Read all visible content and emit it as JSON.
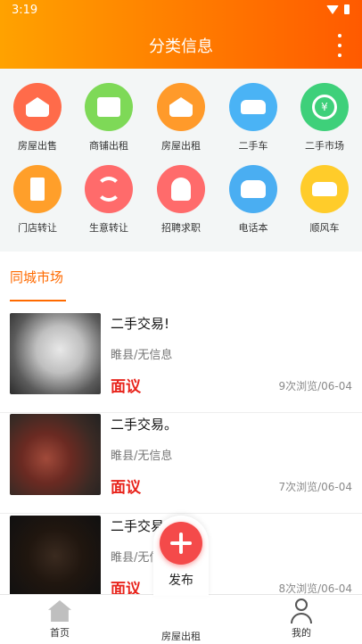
{
  "status_bar": {
    "time": "3:19"
  },
  "header": {
    "title": "分类信息"
  },
  "categories": [
    {
      "label": "房屋出售",
      "icon": "house-sale-icon",
      "color": "#ff6b4a"
    },
    {
      "label": "商铺出租",
      "icon": "shop-icon",
      "color": "#7ed957"
    },
    {
      "label": "房屋出租",
      "icon": "house-rent-icon",
      "color": "#ff9a2a"
    },
    {
      "label": "二手车",
      "icon": "used-car-icon",
      "color": "#4ab3f5"
    },
    {
      "label": "二手市场",
      "icon": "yuan-cycle-icon",
      "color": "#3ed07a"
    },
    {
      "label": "门店转让",
      "icon": "door-icon",
      "color": "#ff9f2a"
    },
    {
      "label": "生意转让",
      "icon": "sync-icon",
      "color": "#ff6b6b"
    },
    {
      "label": "招聘求职",
      "icon": "person-icon",
      "color": "#ff6b6b"
    },
    {
      "label": "电话本",
      "icon": "phone-icon",
      "color": "#4aaef2"
    },
    {
      "label": "顺风车",
      "icon": "car-icon",
      "color": "#ffcc2a"
    }
  ],
  "section": {
    "tab": "同城市场"
  },
  "listings": [
    {
      "title": "二手交易!",
      "location": "睢县/无信息",
      "price": "面议",
      "views": "9次浏览/06-04"
    },
    {
      "title": "二手交易。",
      "location": "睢县/无信息",
      "price": "面议",
      "views": "7次浏览/06-04"
    },
    {
      "title": "二手交易",
      "location": "睢县/无信息",
      "price": "面议",
      "views": "8次浏览/06-04"
    }
  ],
  "publish": {
    "label": "发布"
  },
  "bottom_nav": [
    {
      "label": "首页"
    },
    {
      "label": "房屋出租"
    },
    {
      "label": "我的"
    }
  ]
}
